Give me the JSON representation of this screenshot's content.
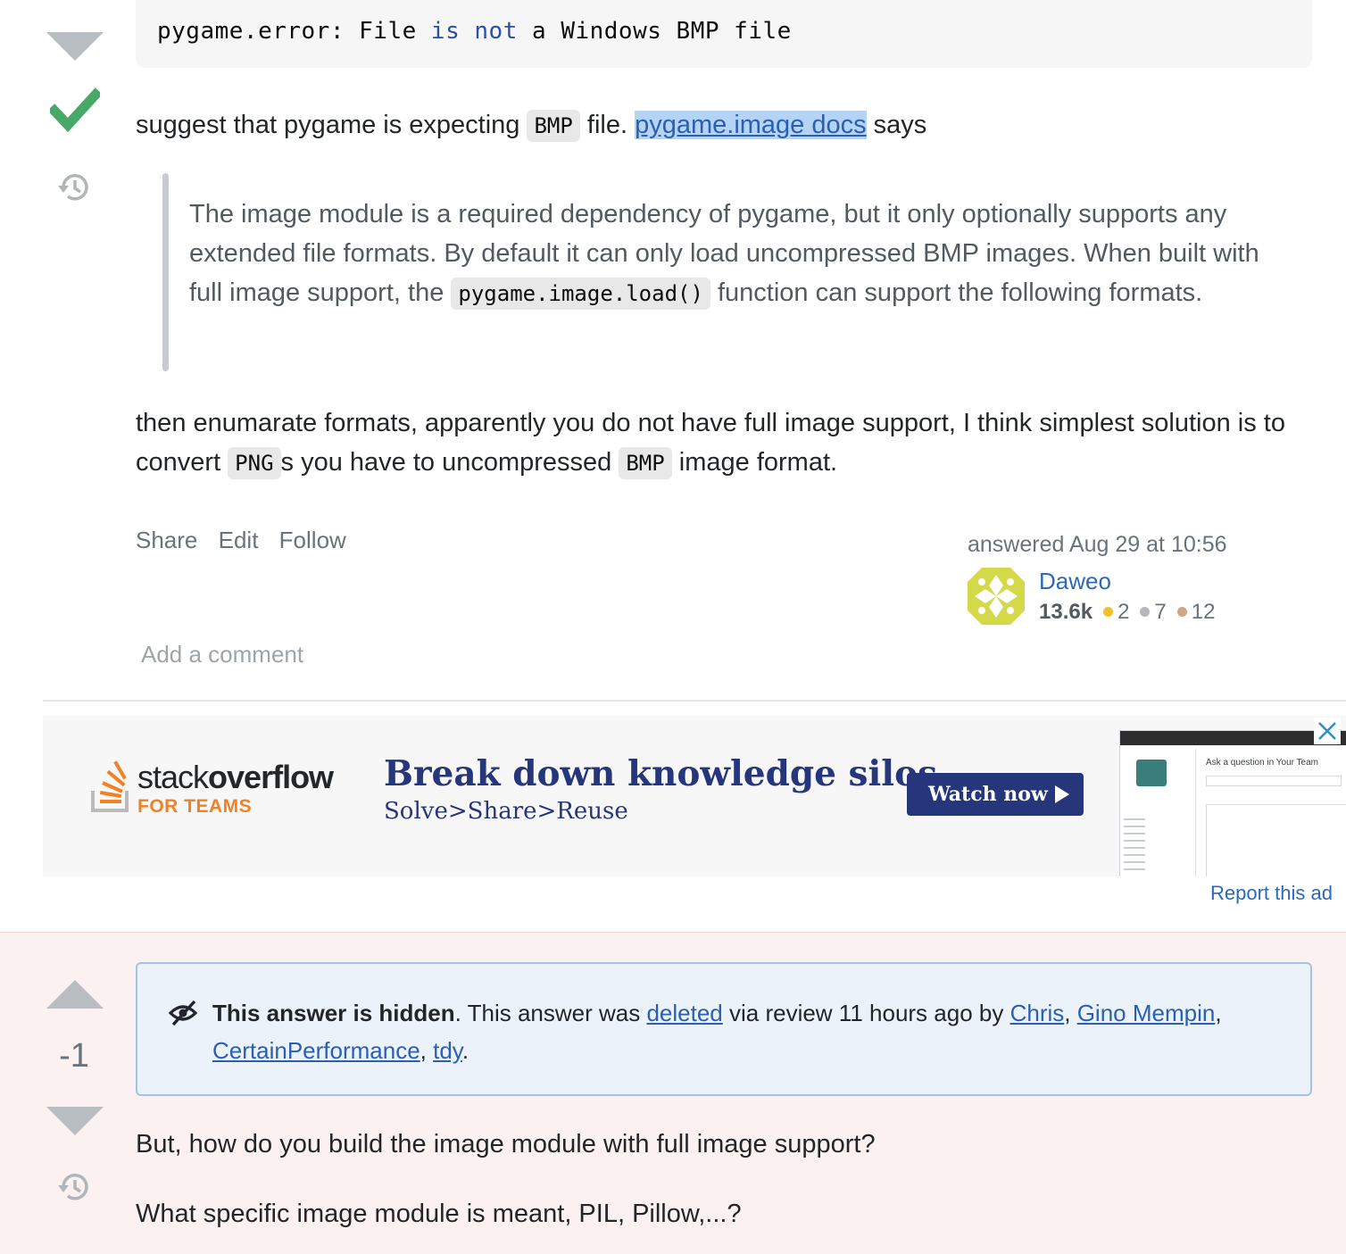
{
  "answer": {
    "code_block": {
      "prefix": "pygame.error: File ",
      "kw1": "is",
      "kw2": "not",
      "suffix": " a Windows BMP file"
    },
    "p1": {
      "before": "suggest that pygame is expecting ",
      "code": "BMP",
      "mid": " file. ",
      "link": "pygame.image docs",
      "after": " says"
    },
    "quote": {
      "before": "The image module is a required dependency of pygame, but it only optionally supports any extended file formats. By default it can only load uncompressed BMP images. When built with full image support, the ",
      "code": "pygame.image.load()",
      "after": " function can support the following formats."
    },
    "p2": {
      "part1": "then enumarate formats, apparently you do not have full image support, I think simplest solution is to convert ",
      "code1": "PNG",
      "part2": "s you have to uncompressed ",
      "code2": "BMP",
      "part3": " image format."
    },
    "menu": {
      "share": "Share",
      "edit": "Edit",
      "follow": "Follow"
    },
    "user_card": {
      "answered": "answered Aug 29 at 10:56",
      "name": "Daweo",
      "reputation": "13.6k",
      "gold": "2",
      "silver": "7",
      "bronze": "12"
    },
    "add_comment": "Add a comment"
  },
  "ad": {
    "brand_light": "stack",
    "brand_bold": "overflow",
    "brand_sub": "FOR TEAMS",
    "title": "Break down knowledge silos",
    "subtitle": "Solve>Share>Reuse",
    "button": "Watch now",
    "thumb_prompt": "Ask a question in Your Team",
    "report": "Report this ad"
  },
  "deleted_answer": {
    "score": "-1",
    "notice": {
      "bold": "This answer is hidden",
      "text1": ". This answer was ",
      "link_deleted": "deleted",
      "text2": " via review 11 hours ago by ",
      "user1": "Chris",
      "user2": "Gino Mempin",
      "user3": "CertainPerformance",
      "user4": "tdy",
      "sep": ", ",
      "end": "."
    },
    "line1": "But, how do you build the image module with full image support?",
    "line2": "What specific image module is meant, PIL, Pillow,...?"
  },
  "colors": {
    "accepted": "#48a868",
    "link": "#2a5fb3",
    "ad_navy": "#26367a",
    "so_orange": "#f48024",
    "deleted_bg": "#fbf1f0",
    "notice_bg": "#ebf2f9"
  },
  "icons": {
    "downvote": "downvote-arrow-icon",
    "upvote": "upvote-arrow-icon",
    "accepted": "checkmark-icon",
    "history": "history-icon",
    "hidden": "eye-slash-icon",
    "close": "close-icon",
    "play": "play-icon"
  }
}
